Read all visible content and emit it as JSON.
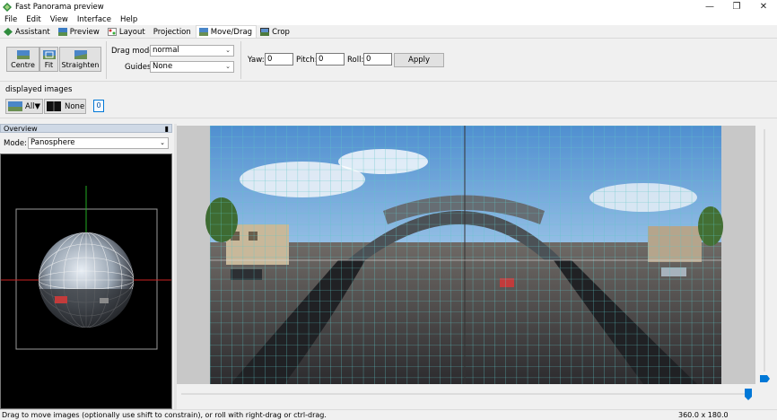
{
  "window": {
    "title": "Fast Panorama preview",
    "controls": {
      "minimize": "—",
      "maximize": "❐",
      "close": "✕"
    }
  },
  "menu": [
    "File",
    "Edit",
    "View",
    "Interface",
    "Help"
  ],
  "tabs": [
    {
      "label": "Assistant",
      "icon": "assistant-icon"
    },
    {
      "label": "Preview",
      "icon": "preview-icon"
    },
    {
      "label": "Layout",
      "icon": "layout-icon"
    },
    {
      "label": "Projection",
      "icon": ""
    },
    {
      "label": "Move/Drag",
      "icon": "move-drag-icon",
      "active": true
    },
    {
      "label": "Crop",
      "icon": "crop-icon"
    }
  ],
  "toolbar": {
    "centre": "Centre",
    "fit": "Fit",
    "straighten": "Straighten",
    "drag_mode_label": "Drag mode:",
    "drag_mode_value": "normal",
    "guides_label": "Guides:",
    "guides_value": "None",
    "yaw_label": "Yaw:",
    "yaw_value": "0",
    "pitch_label": "Pitch:",
    "pitch_value": "0",
    "roll_label": "Roll:",
    "roll_value": "0",
    "apply": "Apply"
  },
  "displayed_images": {
    "label": "displayed images",
    "all": "All▼",
    "none": "None",
    "image_index": "0"
  },
  "overview": {
    "title": "Overview",
    "pin": "▮",
    "mode_label": "Mode:",
    "mode_value": "Panosphere"
  },
  "status": {
    "message": "Drag to move images (optionally use shift to constrain), or roll with right-drag or ctrl-drag.",
    "field_of_view": "360.0 x 180.0"
  },
  "colors": {
    "accent": "#0078d7",
    "sky": "#7fb6e6",
    "grid": "#5ec6c6"
  }
}
